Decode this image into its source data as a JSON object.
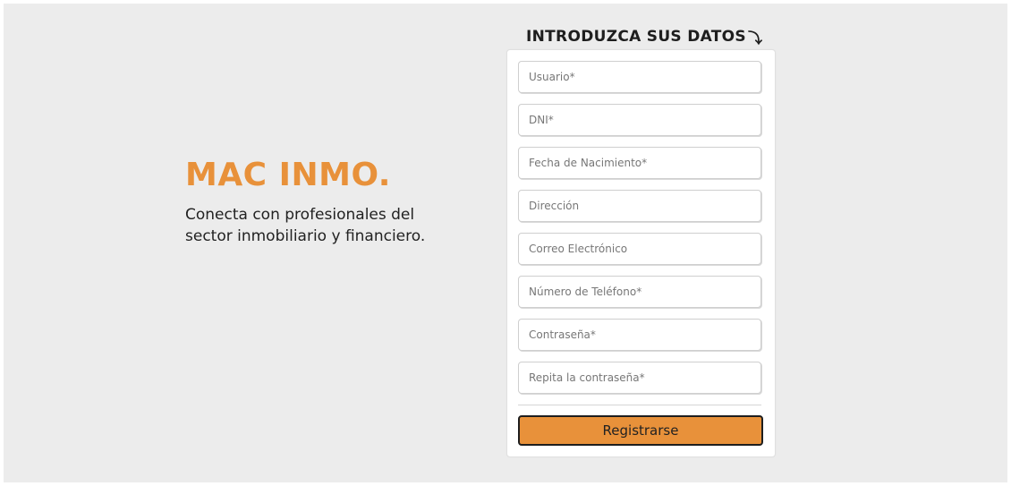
{
  "brand": {
    "title": "MAC INMO.",
    "tagline": "Conecta con profesionales del sector inmobiliario y financiero."
  },
  "form": {
    "heading": "INTRODUZCA SUS DATOS",
    "heading_icon": "arrow-down-turn-icon",
    "fields": [
      {
        "placeholder": "Usuario*",
        "value": ""
      },
      {
        "placeholder": "DNI*",
        "value": ""
      },
      {
        "placeholder": "Fecha de Nacimiento*",
        "value": ""
      },
      {
        "placeholder": "Dirección",
        "value": ""
      },
      {
        "placeholder": "Correo Electrónico",
        "value": ""
      },
      {
        "placeholder": "Número de Teléfono*",
        "value": ""
      },
      {
        "placeholder": "Contraseña*",
        "value": ""
      },
      {
        "placeholder": "Repita la contraseña*",
        "value": ""
      }
    ],
    "submit_label": "Registrarse"
  },
  "colors": {
    "accent": "#e8913a",
    "background": "#ececec",
    "text": "#222222"
  }
}
